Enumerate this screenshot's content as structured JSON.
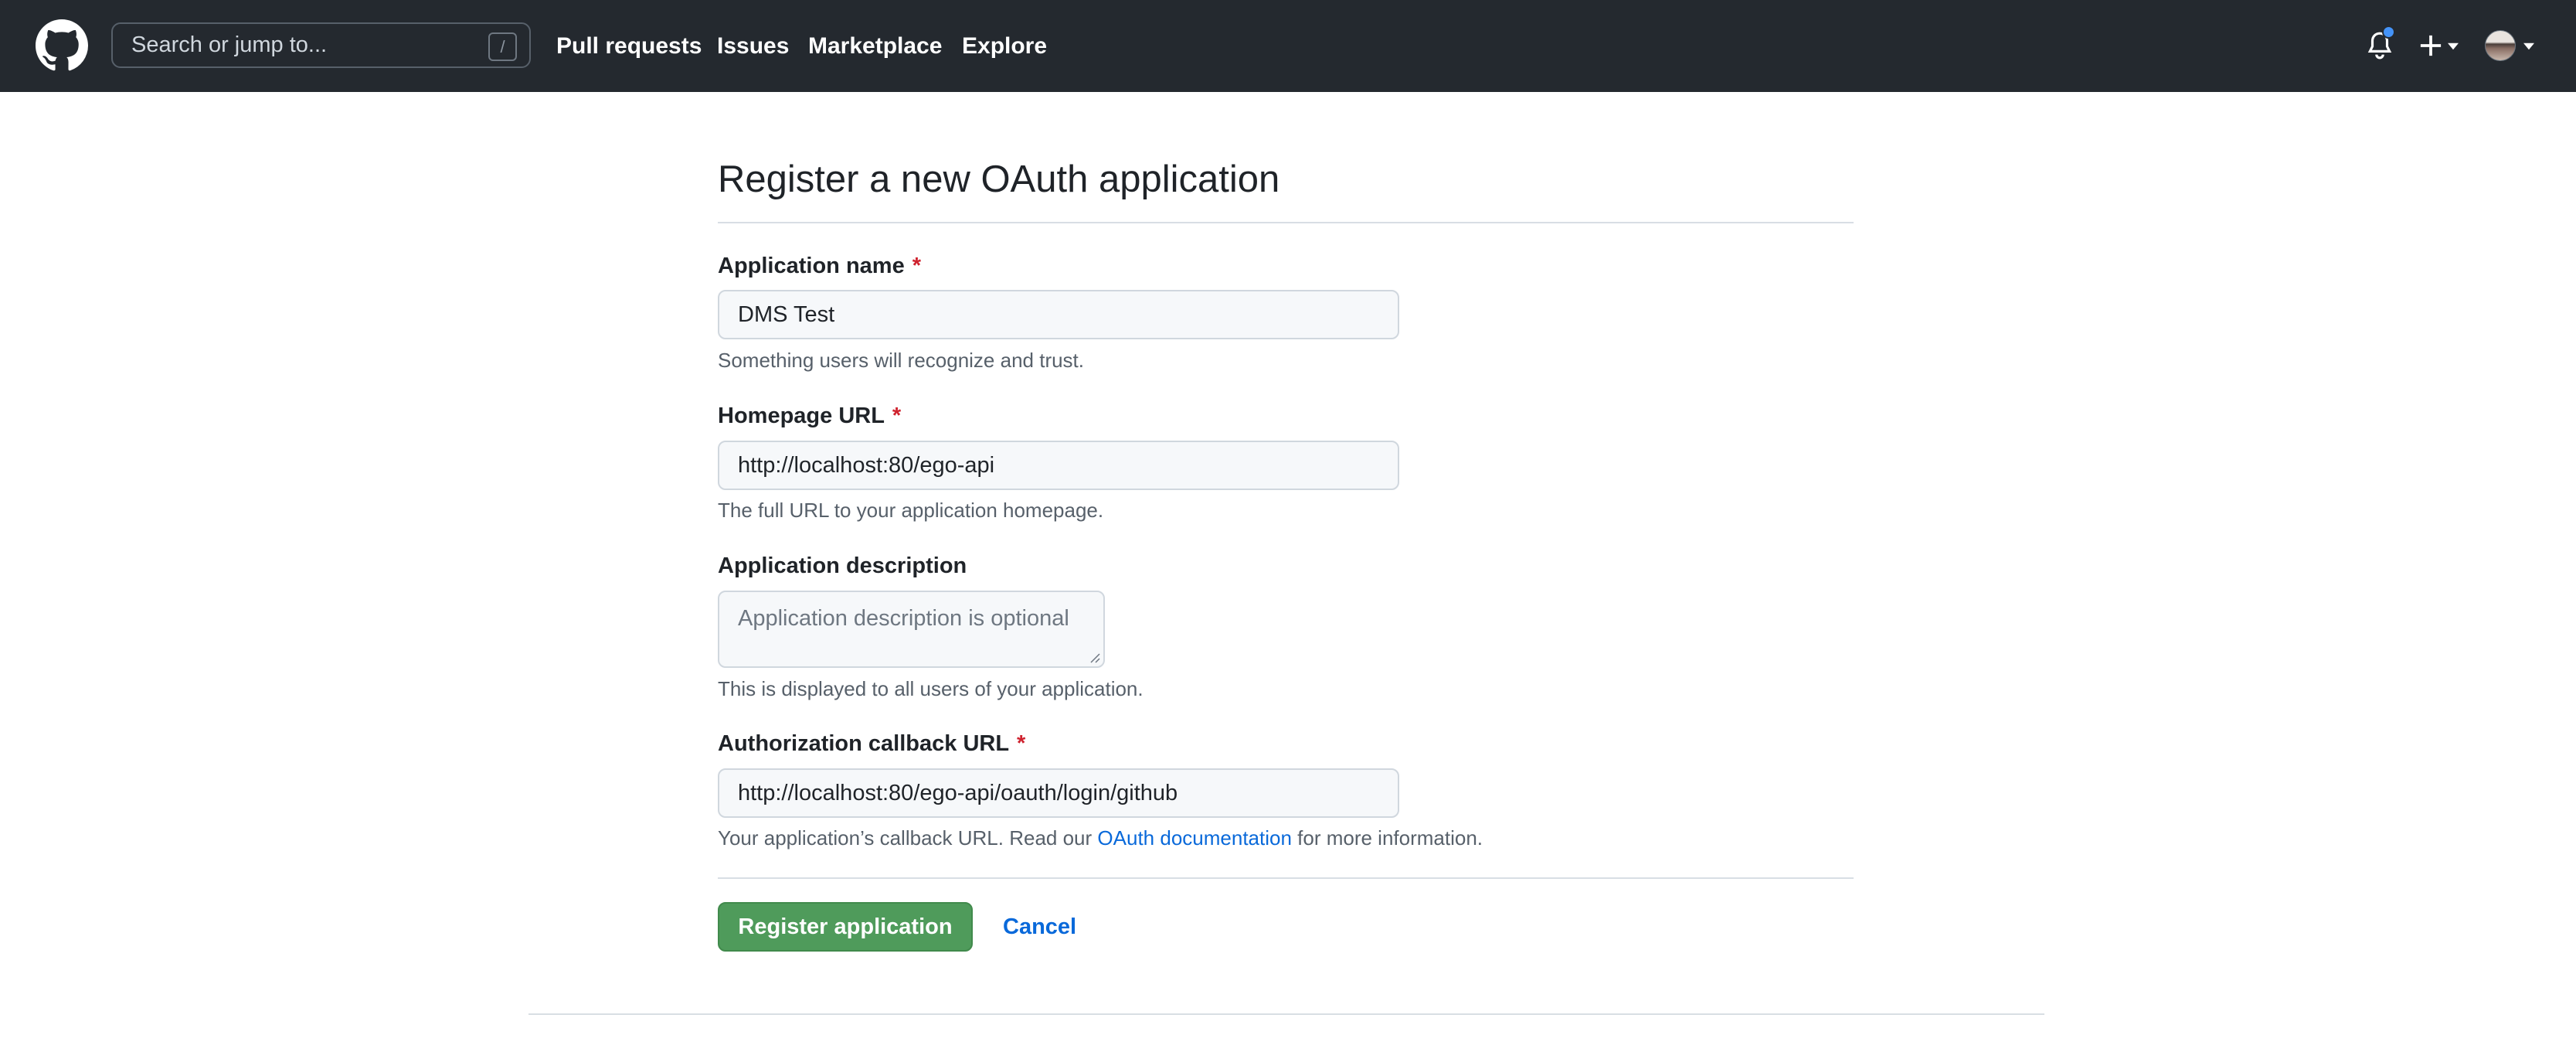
{
  "header": {
    "search_placeholder": "Search or jump to...",
    "search_shortcut": "/",
    "nav": [
      "Pull requests",
      "Issues",
      "Marketplace",
      "Explore"
    ],
    "icons": [
      "github-logo-icon",
      "bell-icon",
      "plus-icon",
      "caret-down-icon",
      "avatar"
    ],
    "notification_dot_color": "#4493f8"
  },
  "form": {
    "title": "Register a new OAuth application",
    "required_marker": "*",
    "app_name": {
      "label": "Application name",
      "value": "DMS Test",
      "note": "Something users will recognize and trust."
    },
    "homepage_url": {
      "label": "Homepage URL",
      "value": "http://localhost:80/ego-api",
      "note": "The full URL to your application homepage."
    },
    "description": {
      "label": "Application description",
      "placeholder": "Application description is optional",
      "note": "This is displayed to all users of your application."
    },
    "callback_url": {
      "label": "Authorization callback URL",
      "value": "http://localhost:80/ego-api/oauth/login/github",
      "note_prefix": "Your application’s callback URL. Read our",
      "note_link": "OAuth documentation",
      "note_suffix": "for more information."
    },
    "register_button": "Register application",
    "cancel_link": "Cancel"
  },
  "colors": {
    "header_bg": "#24292f",
    "primary_button": "#4f9b5b",
    "link": "#0969da",
    "required": "#cf222e"
  }
}
